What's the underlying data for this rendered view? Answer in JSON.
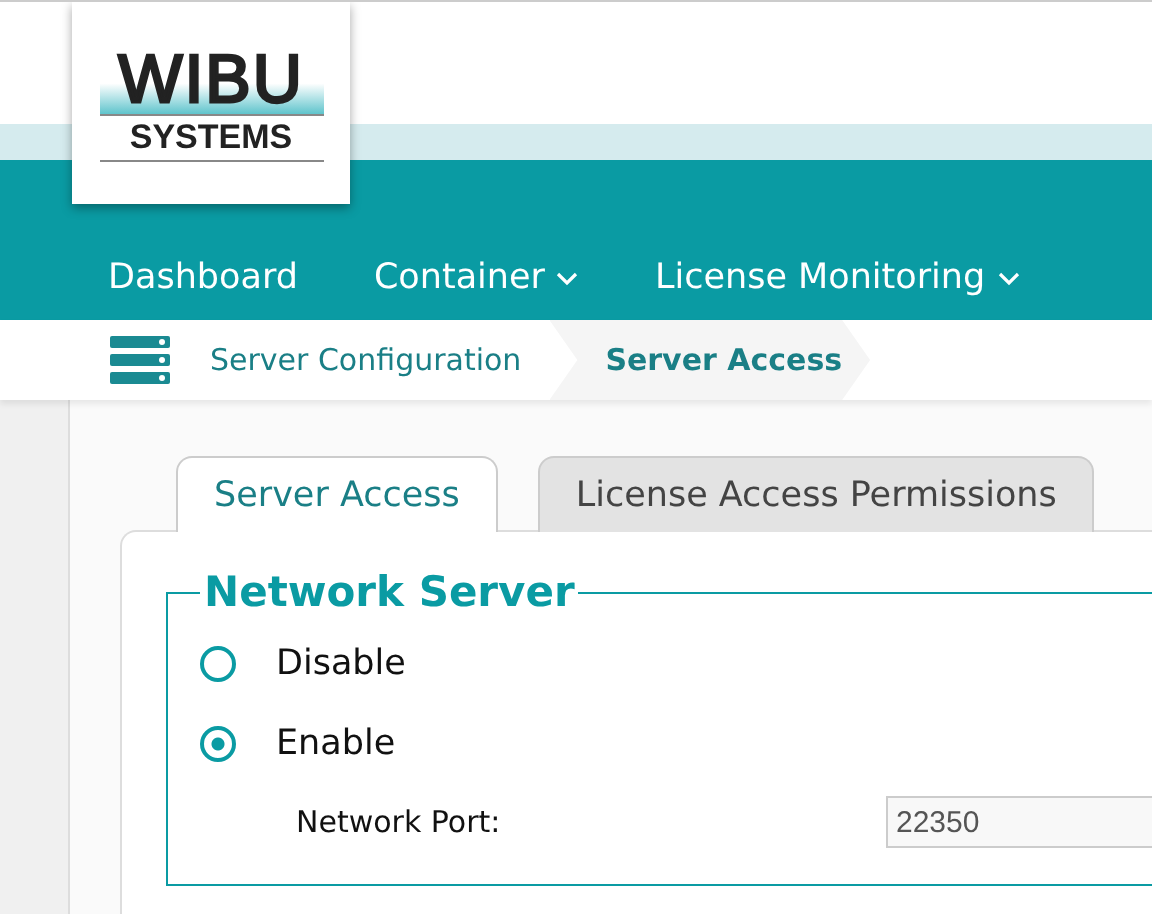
{
  "logo": {
    "top": "WIBU",
    "bottom": "SYSTEMS"
  },
  "nav": [
    {
      "label": "Dashboard",
      "dropdown": false
    },
    {
      "label": "Container",
      "dropdown": true
    },
    {
      "label": "License Monitoring",
      "dropdown": true
    }
  ],
  "breadcrumb": [
    {
      "label": "Server Configuration",
      "current": false
    },
    {
      "label": "Server Access",
      "current": true
    }
  ],
  "tabs": [
    {
      "label": "Server Access",
      "selected": true
    },
    {
      "label": "License Access Permissions",
      "selected": false
    }
  ],
  "fieldset": {
    "legend": "Network Server",
    "options": [
      {
        "label": "Disable",
        "selected": false
      },
      {
        "label": "Enable",
        "selected": true
      }
    ],
    "port": {
      "label": "Network Port:",
      "value": "22350"
    }
  }
}
